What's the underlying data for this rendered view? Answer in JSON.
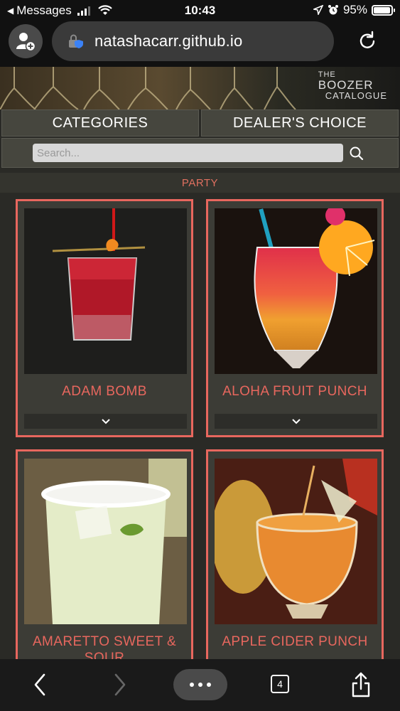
{
  "status_bar": {
    "back_app": "Messages",
    "time": "10:43",
    "battery": "95%",
    "battery_level": 0.95
  },
  "browser": {
    "url": "natashacarr.github.io"
  },
  "site": {
    "brand_line1": "THE",
    "brand_line2": "BOOZER",
    "brand_line3": "CATALOGUE"
  },
  "nav": {
    "categories_label": "CATEGORIES",
    "dealers_choice_label": "DEALER'S CHOICE"
  },
  "search": {
    "placeholder": "Search..."
  },
  "category": {
    "name": "PARTY"
  },
  "drinks": [
    {
      "name": "ADAM BOMB"
    },
    {
      "name": "ALOHA FRUIT PUNCH"
    },
    {
      "name": "AMARETTO SWEET & SOUR"
    },
    {
      "name": "APPLE CIDER PUNCH"
    }
  ],
  "toolbar": {
    "tab_count": "4"
  },
  "colors": {
    "accent": "#e8675e",
    "background": "#2a2a26",
    "nav_button": "#46463e"
  }
}
